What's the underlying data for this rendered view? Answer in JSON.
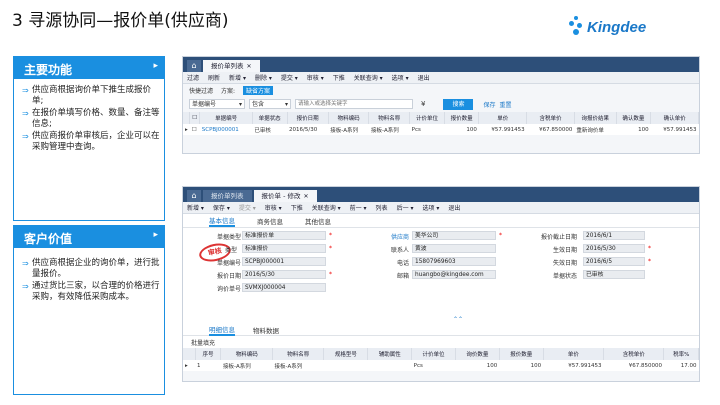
{
  "title": "3 寻源协同—报价单(供应商)",
  "logo_text": "Kingdee",
  "colors": {
    "accent": "#1a8fe0",
    "navy": "#2d4f79",
    "search": "#1a8fe0"
  },
  "panel_main": {
    "title": "主要功能",
    "items": [
      "供应商根据询价单下推生成报价单;",
      "在报价单填写价格、数量、备注等信息;",
      "供应商报价单审核后，企业可以在采购管理中查询。"
    ]
  },
  "panel_value": {
    "title": "客户价值",
    "items": [
      "供应商根据企业的询价单，进行批量报价。",
      "通过货比三家，以合理的价格进行采购，有效降低采购成本。"
    ]
  },
  "win1": {
    "tabs": [
      "报价单列表"
    ],
    "toolbar": [
      "过滤",
      "刷新",
      "新增 ▾",
      "删除 ▾",
      "提交 ▾",
      "审核 ▾",
      "下推",
      "关联查询 ▾",
      "选项 ▾",
      "退出"
    ],
    "quick": [
      "快捷过滤",
      "方案:",
      "缺省方案"
    ],
    "filter_field": "单据编号",
    "filter_op": "包含",
    "search_placeholder": "请输入或选择关键字",
    "search_btn": "搜索",
    "save_link": "保存",
    "reset_link": "重置",
    "headers": [
      "单据编号",
      "单据状态",
      "报价日期",
      "物料编码",
      "物料名称",
      "计价单位",
      "报价数量",
      "单价",
      "含税单价",
      "询报价结果",
      "确认数量",
      "确认单价"
    ],
    "row": [
      "SCPBJ000001",
      "已审核",
      "2016/5/30",
      "接板-A系列",
      "接板-A系列",
      "Pcs",
      "100",
      "¥57.991453",
      "¥67.850000",
      "重新询价单",
      "100",
      "¥57.991453"
    ]
  },
  "win2": {
    "tabs": [
      "报价单列表",
      "报价单 - 修改"
    ],
    "toolbar": [
      "新增 ▾",
      "保存 ▾",
      "提交 ▾",
      "审核 ▾",
      "下推",
      "关联查询 ▾",
      "前一 ▾",
      "列表",
      "后一 ▾",
      "选项 ▾",
      "退出"
    ],
    "subtabs": [
      "基本信息",
      "商务信息",
      "其他信息"
    ],
    "stamp": "审核",
    "fields_left": [
      {
        "label": "单据类型",
        "value": "标准报价单"
      },
      {
        "label": "类型",
        "value": "标准报价"
      },
      {
        "label": "单据编号",
        "value": "SCPBJ000001"
      },
      {
        "label": "报价日期",
        "value": "2016/5/30"
      },
      {
        "label": "询价单号",
        "value": "SVMXJ000004"
      }
    ],
    "fields_mid": [
      {
        "label": "供应商",
        "value": "美华公司"
      },
      {
        "label": "联系人",
        "value": "黄波"
      },
      {
        "label": "电话",
        "value": "15807969603"
      },
      {
        "label": "邮箱",
        "value": "huangbo@kingdee.com"
      }
    ],
    "fields_right": [
      {
        "label": "报价截止日期",
        "value": "2016/6/1"
      },
      {
        "label": "生效日期",
        "value": "2016/5/30"
      },
      {
        "label": "失效日期",
        "value": "2016/6/5"
      },
      {
        "label": "单据状态",
        "value": "已审核"
      }
    ],
    "detail_tabs": [
      "明细信息",
      "物料数据"
    ],
    "batch": "批量填充",
    "headers": [
      "序号",
      "物料编码",
      "物料名称",
      "规格型号",
      "辅助属性",
      "计价单位",
      "询价数量",
      "报价数量",
      "单价",
      "含税单价",
      "税率%"
    ],
    "row": [
      "1",
      "接板-A系列",
      "接板-A系列",
      "",
      "",
      "Pcs",
      "100",
      "100",
      "¥57.991453",
      "¥67.850000",
      "17.00"
    ]
  }
}
